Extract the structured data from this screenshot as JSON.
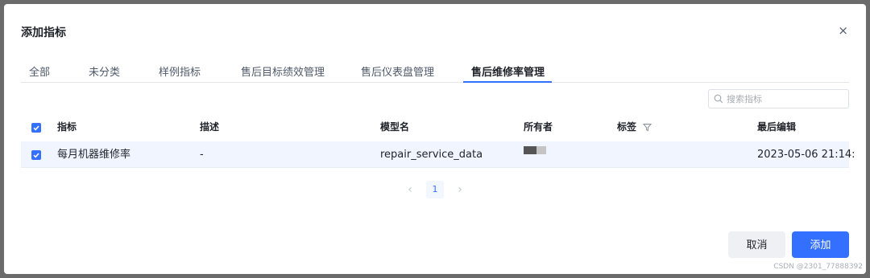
{
  "dialog": {
    "title": "添加指标",
    "close_icon": "×"
  },
  "tabs": [
    {
      "label": "全部"
    },
    {
      "label": "未分类"
    },
    {
      "label": "样例指标"
    },
    {
      "label": "售后目标绩效管理"
    },
    {
      "label": "售后仪表盘管理"
    },
    {
      "label": "售后维修率管理",
      "active": true
    }
  ],
  "search": {
    "placeholder": "搜索指标",
    "value": ""
  },
  "table": {
    "columns": [
      "指标",
      "描述",
      "模型名",
      "所有者",
      "标签",
      "最后编辑"
    ],
    "rows": [
      {
        "checked": true,
        "metric": "每月机器维修率",
        "description": "-",
        "model": "repair_service_data",
        "owner_avatar_colors": [
          "#555555",
          "#c4c4c4"
        ],
        "tags": "",
        "last_edited": "2023-05-06 21:14:"
      }
    ]
  },
  "pagination": {
    "prev": "‹",
    "current": "1",
    "next": "›"
  },
  "footer": {
    "cancel_label": "取消",
    "confirm_label": "添加"
  },
  "watermark": "CSDN @2301_77888392",
  "colors": {
    "accent": "#3370ff",
    "selected_row": "#f0f5ff"
  }
}
